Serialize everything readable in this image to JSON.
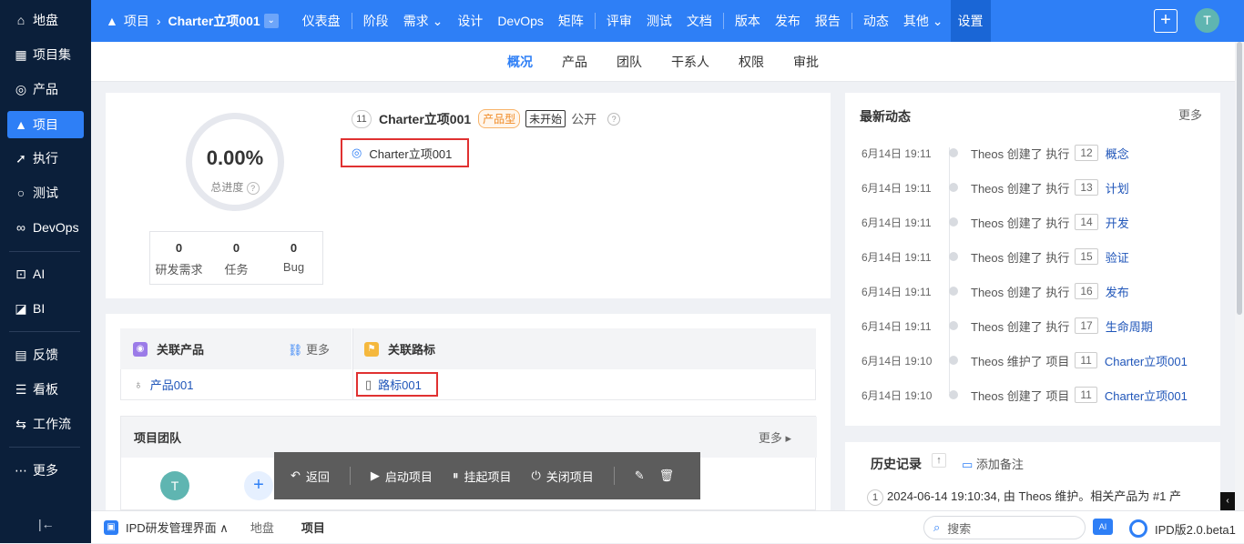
{
  "sidebar": {
    "items": [
      {
        "label": "地盘",
        "icon": "home-icon"
      },
      {
        "label": "项目集",
        "icon": "grid-icon"
      },
      {
        "label": "产品",
        "icon": "bulb-icon"
      },
      {
        "label": "项目",
        "icon": "rocket-icon",
        "active": true
      },
      {
        "label": "执行",
        "icon": "run-icon"
      },
      {
        "label": "测试",
        "icon": "magnify-icon"
      },
      {
        "label": "DevOps",
        "icon": "infinity-icon"
      },
      {
        "label": "AI",
        "icon": "robot-icon"
      },
      {
        "label": "BI",
        "icon": "chart-icon"
      },
      {
        "label": "反馈",
        "icon": "feedback-icon"
      },
      {
        "label": "看板",
        "icon": "kanban-icon"
      },
      {
        "label": "工作流",
        "icon": "workflow-icon"
      },
      {
        "label": "更多",
        "icon": "more-icon"
      }
    ],
    "collapse_icon": "|←"
  },
  "topbar": {
    "breadcrumb_root": "项目",
    "breadcrumb_current": "Charter立项001",
    "nav": [
      "仪表盘",
      "阶段",
      "需求 ⌄",
      "设计",
      "DevOps",
      "矩阵",
      "评审",
      "测试",
      "文档",
      "版本",
      "发布",
      "报告",
      "动态",
      "其他 ⌄",
      "设置"
    ],
    "avatar": "T"
  },
  "subnav": [
    "概况",
    "产品",
    "团队",
    "干系人",
    "权限",
    "审批"
  ],
  "overview": {
    "progress": "0.00%",
    "progress_label": "总进度",
    "stats": [
      {
        "n": "0",
        "label": "研发需求"
      },
      {
        "n": "0",
        "label": "任务"
      },
      {
        "n": "0",
        "label": "Bug"
      }
    ],
    "id": "11",
    "name": "Charter立项001",
    "type_tag": "产品型",
    "status_tag": "未开始",
    "visibility": "公开",
    "program_name": "Charter立项001"
  },
  "linked": {
    "product_header": "关联产品",
    "more": "更多",
    "roadmap_header": "关联路标",
    "product": "产品001",
    "roadmap": "路标001"
  },
  "team": {
    "title": "项目团队",
    "more": "更多",
    "avatar": "T",
    "add": "+"
  },
  "feed": {
    "title": "最新动态",
    "more": "更多",
    "items": [
      {
        "time": "6月14日 19:11",
        "who": "Theos 创建了 执行",
        "id": "12",
        "target": "概念"
      },
      {
        "time": "6月14日 19:11",
        "who": "Theos 创建了 执行",
        "id": "13",
        "target": "计划"
      },
      {
        "time": "6月14日 19:11",
        "who": "Theos 创建了 执行",
        "id": "14",
        "target": "开发"
      },
      {
        "time": "6月14日 19:11",
        "who": "Theos 创建了 执行",
        "id": "15",
        "target": "验证"
      },
      {
        "time": "6月14日 19:11",
        "who": "Theos 创建了 执行",
        "id": "16",
        "target": "发布"
      },
      {
        "time": "6月14日 19:11",
        "who": "Theos 创建了 执行",
        "id": "17",
        "target": "生命周期"
      },
      {
        "time": "6月14日 19:10",
        "who": "Theos 维护了 项目",
        "id": "11",
        "target": "Charter立项001"
      },
      {
        "time": "6月14日 19:10",
        "who": "Theos 创建了 项目",
        "id": "11",
        "target": "Charter立项001"
      }
    ]
  },
  "history": {
    "title": "历史记录",
    "add_note": "添加备注",
    "line_index": "1",
    "line_text": "2024-06-14 19:10:34, 由 Theos 维护。相关产品为 #1 产"
  },
  "actions": {
    "back": "返回",
    "start": "启动项目",
    "suspend": "挂起项目",
    "close": "关闭项目"
  },
  "bottombar": {
    "app": "IPD研发管理界面 ∧",
    "crumb": "地盘",
    "current": "项目",
    "search_placeholder": "搜索",
    "ai": "AI",
    "version": "IPD版2.0.beta1"
  }
}
